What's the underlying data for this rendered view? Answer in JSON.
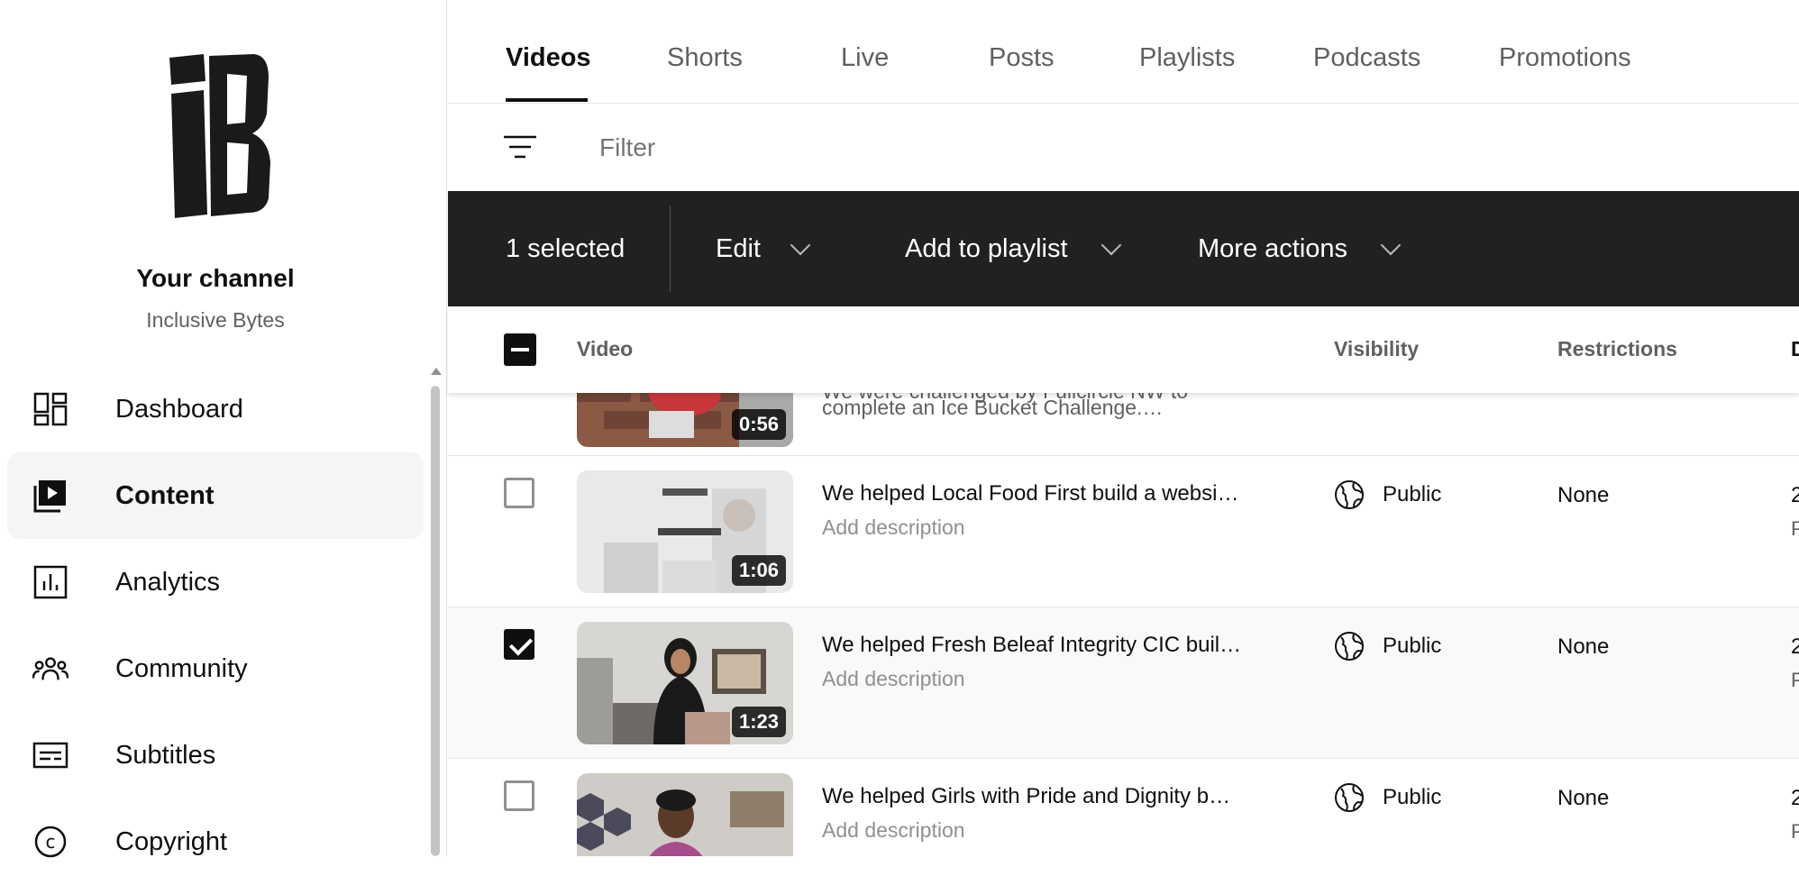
{
  "sidebar": {
    "channel_title": "Your channel",
    "channel_name": "Inclusive Bytes",
    "items": [
      {
        "label": "Dashboard",
        "icon": "dashboard-icon"
      },
      {
        "label": "Content",
        "icon": "content-icon",
        "active": true
      },
      {
        "label": "Analytics",
        "icon": "analytics-icon"
      },
      {
        "label": "Community",
        "icon": "community-icon"
      },
      {
        "label": "Subtitles",
        "icon": "subtitles-icon"
      },
      {
        "label": "Copyright",
        "icon": "copyright-icon"
      }
    ]
  },
  "tabs": [
    "Videos",
    "Shorts",
    "Live",
    "Posts",
    "Playlists",
    "Podcasts",
    "Promotions"
  ],
  "filter": {
    "placeholder": "Filter"
  },
  "actionbar": {
    "selected": "1 selected",
    "edit": "Edit",
    "add_to_playlist": "Add to playlist",
    "more_actions": "More actions"
  },
  "table": {
    "headers": {
      "video": "Video",
      "visibility": "Visibility",
      "restrictions": "Restrictions",
      "date": "D"
    },
    "rows": [
      {
        "title": "",
        "desc_line1": "We were challenged by Fullcircle NW to",
        "desc_line2": "complete an Ice Bucket Challenge.…",
        "duration": "0:56",
        "visibility": "",
        "restrictions": "",
        "date": "",
        "checked": false
      },
      {
        "title": "We helped Local Food First build a websi…",
        "desc": "Add description",
        "duration": "1:06",
        "visibility": "Public",
        "restrictions": "None",
        "date": "2",
        "date2": "P",
        "checked": false
      },
      {
        "title": "We helped Fresh Beleaf Integrity CIC buil…",
        "desc": "Add description",
        "duration": "1:23",
        "visibility": "Public",
        "restrictions": "None",
        "date": "2",
        "date2": "P",
        "checked": true
      },
      {
        "title": "We helped Girls with Pride and Dignity b…",
        "desc": "Add description",
        "duration": "",
        "visibility": "Public",
        "restrictions": "None",
        "date": "2",
        "date2": "P",
        "checked": false
      }
    ]
  },
  "colors": {
    "actionbar_bg": "#212121",
    "selected_row_bg": "#f9f9f9"
  }
}
